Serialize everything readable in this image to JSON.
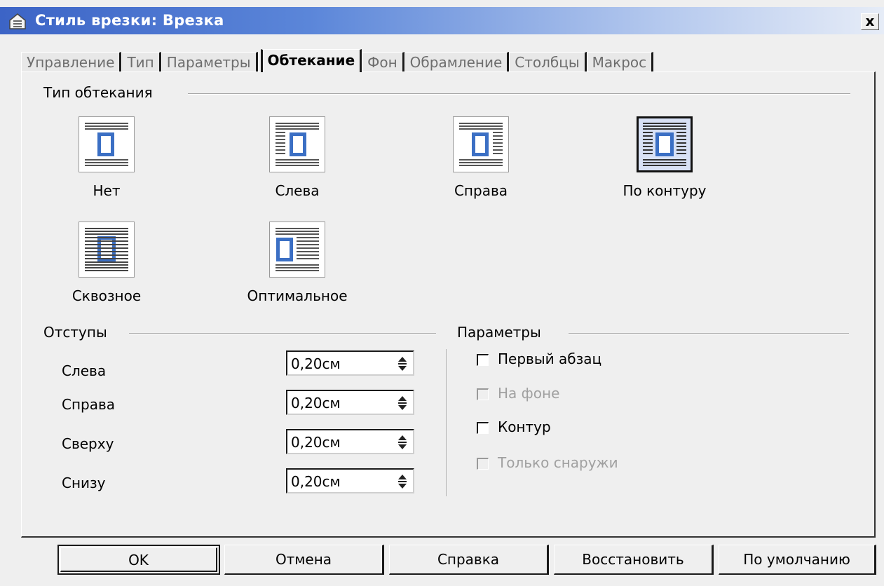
{
  "window": {
    "title": "Стиль врезки: Врезка",
    "close_label": "x"
  },
  "tabs": [
    {
      "label": "Управление"
    },
    {
      "label": "Тип"
    },
    {
      "label": "Параметры"
    },
    {
      "label": "Обтекание",
      "active": true
    },
    {
      "label": "Фон"
    },
    {
      "label": "Обрамление"
    },
    {
      "label": "Столбцы"
    },
    {
      "label": "Макрос"
    }
  ],
  "wrap_type": {
    "title": "Тип обтекания",
    "selected": "По контуру",
    "options": [
      {
        "label": "Нет"
      },
      {
        "label": "Слева"
      },
      {
        "label": "Справа"
      },
      {
        "label": "По контуру"
      },
      {
        "label": "Сквозное"
      },
      {
        "label": "Оптимальное"
      }
    ]
  },
  "spacing": {
    "title": "Отступы",
    "fields": [
      {
        "label": "Слева",
        "value": "0,20см"
      },
      {
        "label": "Справа",
        "value": "0,20см"
      },
      {
        "label": "Сверху",
        "value": "0,20см"
      },
      {
        "label": "Снизу",
        "value": "0,20см"
      }
    ]
  },
  "options": {
    "title": "Параметры",
    "items": [
      {
        "label": "Первый абзац",
        "checked": false,
        "enabled": true
      },
      {
        "label": "На фоне",
        "checked": false,
        "enabled": false
      },
      {
        "label": "Контур",
        "checked": false,
        "enabled": true
      },
      {
        "label": "Только снаружи",
        "checked": false,
        "enabled": false
      }
    ]
  },
  "buttons": {
    "ok": "OK",
    "cancel": "Отмена",
    "help": "Справка",
    "reset": "Восстановить",
    "standard": "По умолчанию"
  },
  "colors": {
    "title_bar_start": "#3c64c6",
    "dialog_bg": "#efefef",
    "icon_blue": "#3b6fc4"
  }
}
